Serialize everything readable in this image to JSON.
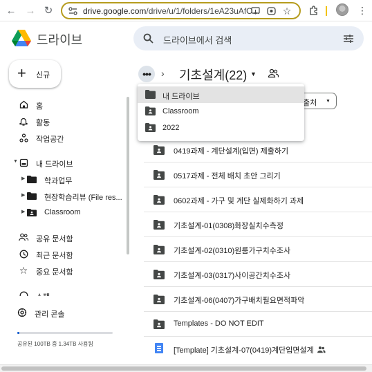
{
  "browser": {
    "url_host": "drive.google.com",
    "url_path": "/drive/u/1/folders/1eA23uAfO..."
  },
  "app": {
    "name": "드라이브"
  },
  "search": {
    "placeholder": "드라이브에서 검색"
  },
  "sidebar": {
    "new_label": "신규",
    "items": [
      {
        "label": "홈"
      },
      {
        "label": "활동"
      },
      {
        "label": "작업공간"
      },
      {
        "label": "내 드라이브"
      },
      {
        "label": "학과업무"
      },
      {
        "label": "현장학습리뷰 (File res..."
      },
      {
        "label": "Classroom"
      },
      {
        "label": "공유 문서함"
      },
      {
        "label": "최근 문서함"
      },
      {
        "label": "중요 문서함"
      },
      {
        "label": "스팸"
      },
      {
        "label": "관리 콘솔"
      }
    ],
    "storage": {
      "text": "공유된 100TB 중 1.34TB 사용됨",
      "used_fraction": 0.0134
    }
  },
  "breadcrumb": {
    "folder_title": "기초설계(22)"
  },
  "filter_chip": {
    "label": "출처"
  },
  "breadcrumb_menu": {
    "items": [
      {
        "label": "내 드라이브",
        "icon": "folder-icon"
      },
      {
        "label": "Classroom",
        "icon": "shared-folder-icon"
      },
      {
        "label": "2022",
        "icon": "shared-folder-icon"
      }
    ]
  },
  "files": [
    {
      "name": "0419과제 - 계단설계(입면) 제출하기",
      "type": "shared-folder"
    },
    {
      "name": "0517과제 - 전체 배치 초안 그리기",
      "type": "shared-folder"
    },
    {
      "name": "0602과제 - 가구 및 계단 실제화하기 과제",
      "type": "shared-folder"
    },
    {
      "name": "기초설계-01(0308)화장실치수측정",
      "type": "shared-folder"
    },
    {
      "name": "기초설계-02(0310)원룸가구치수조사",
      "type": "shared-folder"
    },
    {
      "name": "기초설계-03(0317)사이공간치수조사",
      "type": "shared-folder"
    },
    {
      "name": "기초설계-06(0407)가구배치필요면적파악",
      "type": "shared-folder"
    },
    {
      "name": "Templates - DO NOT EDIT",
      "type": "shared-folder"
    },
    {
      "name": "[Template] 기초설계-07(0419)계단입면설계",
      "type": "doc"
    }
  ],
  "colors": {
    "accent": "#0b57d0",
    "search_bg": "#e9eef6",
    "omnibox_border": "#b69c1e",
    "menu_hover": "#e3e3e3"
  }
}
